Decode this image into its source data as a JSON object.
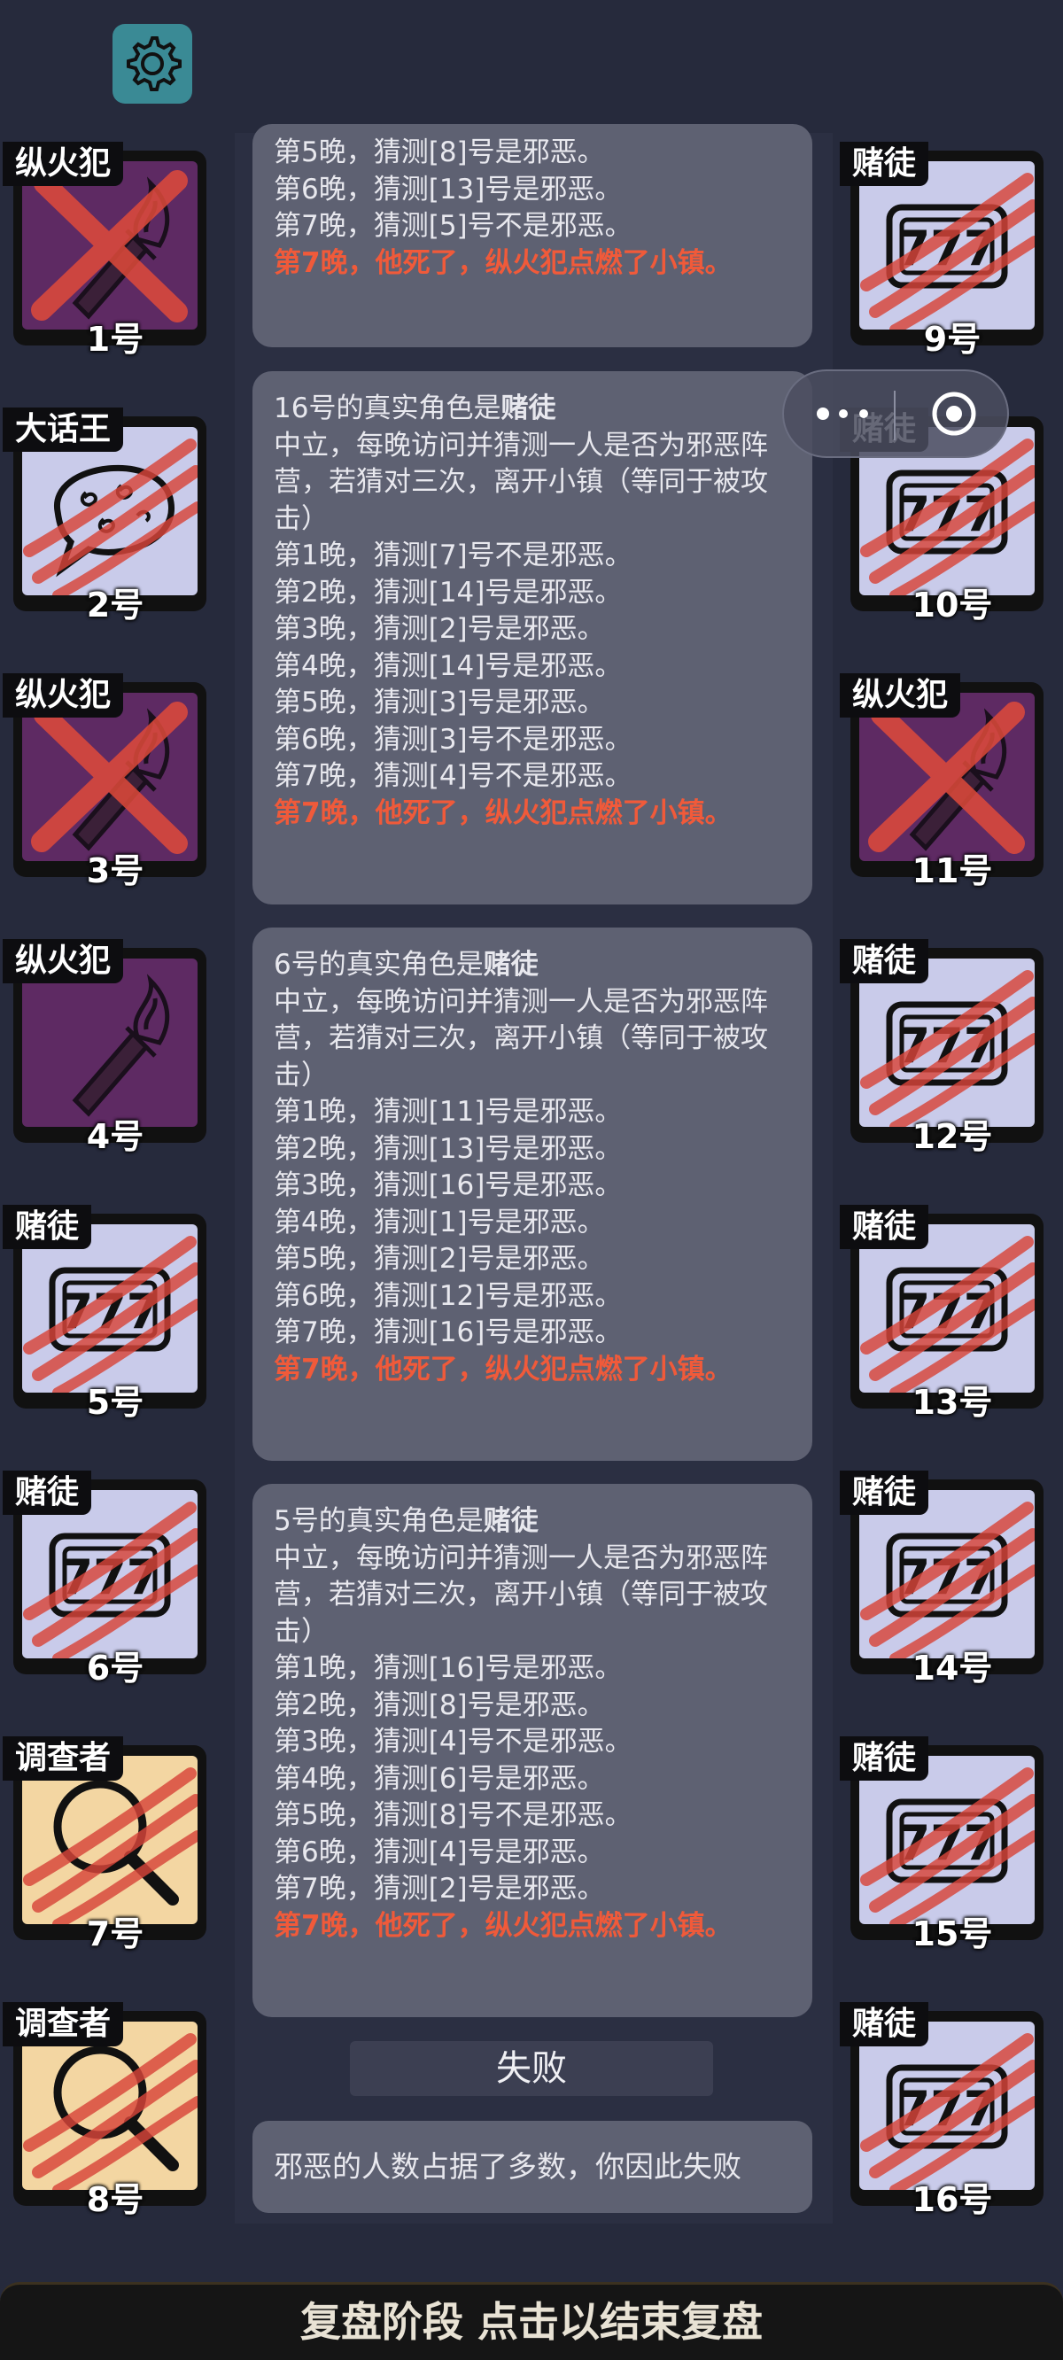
{
  "players": [
    {
      "num": "1号",
      "role": "纵火犯",
      "style": "purple",
      "icon": "torch-icon",
      "dead": "x"
    },
    {
      "num": "2号",
      "role": "大话王",
      "style": "lav",
      "icon": "speech-bubble-icon",
      "dead": "claw"
    },
    {
      "num": "3号",
      "role": "纵火犯",
      "style": "purple",
      "icon": "torch-icon",
      "dead": "x"
    },
    {
      "num": "4号",
      "role": "纵火犯",
      "style": "purple",
      "icon": "torch-icon",
      "dead": ""
    },
    {
      "num": "5号",
      "role": "赌徒",
      "style": "lav",
      "icon": "slot-777-icon",
      "dead": "claw"
    },
    {
      "num": "6号",
      "role": "赌徒",
      "style": "lav",
      "icon": "slot-777-icon",
      "dead": "claw"
    },
    {
      "num": "7号",
      "role": "调查者",
      "style": "sand",
      "icon": "magnifier-icon",
      "dead": "claw"
    },
    {
      "num": "8号",
      "role": "调查者",
      "style": "sand",
      "icon": "magnifier-icon",
      "dead": "claw"
    },
    {
      "num": "9号",
      "role": "赌徒",
      "style": "lav",
      "icon": "slot-777-icon",
      "dead": "claw"
    },
    {
      "num": "10号",
      "role": "赌徒",
      "style": "lav",
      "icon": "slot-777-icon",
      "dead": "claw"
    },
    {
      "num": "11号",
      "role": "纵火犯",
      "style": "purple",
      "icon": "torch-icon",
      "dead": "x"
    },
    {
      "num": "12号",
      "role": "赌徒",
      "style": "lav",
      "icon": "slot-777-icon",
      "dead": "claw"
    },
    {
      "num": "13号",
      "role": "赌徒",
      "style": "lav",
      "icon": "slot-777-icon",
      "dead": "claw"
    },
    {
      "num": "14号",
      "role": "赌徒",
      "style": "lav",
      "icon": "slot-777-icon",
      "dead": "claw"
    },
    {
      "num": "15号",
      "role": "赌徒",
      "style": "lav",
      "icon": "slot-777-icon",
      "dead": "claw"
    },
    {
      "num": "16号",
      "role": "赌徒",
      "style": "lav",
      "icon": "slot-777-icon",
      "dead": "claw"
    }
  ],
  "logs": [
    {
      "title_prefix": "",
      "title_role": "",
      "lines": [
        "第5晚，猜测[8]号是邪恶。",
        "第6晚，猜测[13]号是邪恶。",
        "第7晚，猜测[5]号不是邪恶。"
      ],
      "death": "第7晚，他死了，纵火犯点燃了小镇。"
    },
    {
      "title_prefix": "16号的真实角色是",
      "title_role": "赌徒",
      "lines": [
        "中立，每晚访问并猜测一人是否为邪恶阵营，若猜对三次，离开小镇（等同于被攻击）",
        "第1晚，猜测[7]号不是邪恶。",
        "第2晚，猜测[14]号是邪恶。",
        "第3晚，猜测[2]号是邪恶。",
        "第4晚，猜测[14]号是邪恶。",
        "第5晚，猜测[3]号是邪恶。",
        "第6晚，猜测[3]号不是邪恶。",
        "第7晚，猜测[4]号不是邪恶。"
      ],
      "death": "第7晚，他死了，纵火犯点燃了小镇。"
    },
    {
      "title_prefix": "6号的真实角色是",
      "title_role": "赌徒",
      "lines": [
        "中立，每晚访问并猜测一人是否为邪恶阵营，若猜对三次，离开小镇（等同于被攻击）",
        "第1晚，猜测[11]号是邪恶。",
        "第2晚，猜测[13]号是邪恶。",
        "第3晚，猜测[16]号是邪恶。",
        "第4晚，猜测[1]号是邪恶。",
        "第5晚，猜测[2]号是邪恶。",
        "第6晚，猜测[12]号是邪恶。",
        "第7晚，猜测[16]号是邪恶。"
      ],
      "death": "第7晚，他死了，纵火犯点燃了小镇。"
    },
    {
      "title_prefix": "5号的真实角色是",
      "title_role": "赌徒",
      "lines": [
        "中立，每晚访问并猜测一人是否为邪恶阵营，若猜对三次，离开小镇（等同于被攻击）",
        "第1晚，猜测[16]号是邪恶。",
        "第2晚，猜测[8]号是邪恶。",
        "第3晚，猜测[4]号不是邪恶。",
        "第4晚，猜测[6]号是邪恶。",
        "第5晚，猜测[8]号不是邪恶。",
        "第6晚，猜测[4]号是邪恶。",
        "第7晚，猜测[2]号是邪恶。"
      ],
      "death": "第7晚，他死了，纵火犯点燃了小镇。"
    }
  ],
  "result_button": "失败",
  "result_message": "邪恶的人数占据了多数，你因此失败",
  "bottom_bar": "复盘阶段 点击以结束复盘",
  "colors": {
    "background": "#262a3c",
    "log_bg": "#5e6172",
    "death_text": "#f05a3a",
    "purple": "#5e2a63",
    "lavender": "#c9cbea",
    "sand": "#f3d6a2",
    "claw": "#d8453a"
  }
}
